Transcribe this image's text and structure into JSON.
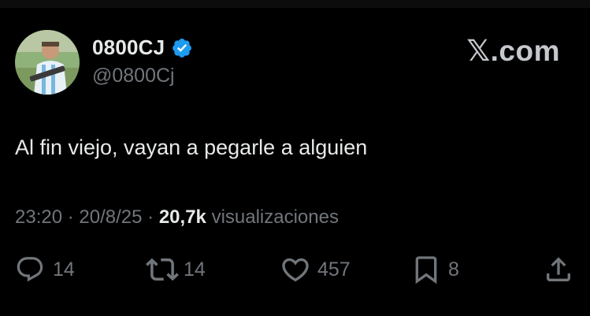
{
  "colors": {
    "background": "#000000",
    "primary_text": "#e7e9ea",
    "secondary_text": "#71767b",
    "verified_badge": "#1d9bf0"
  },
  "author": {
    "display_name": "0800CJ",
    "handle": "@0800Cj",
    "verified": true
  },
  "brand": "𝕏.com",
  "tweet": {
    "text": "Al fin viejo, vayan a pegarle a alguien"
  },
  "meta": {
    "time": "23:20",
    "date": "20/8/25",
    "views_count": "20,7k",
    "views_label": "visualizaciones",
    "separator": "·"
  },
  "actions": {
    "replies": "14",
    "reposts": "14",
    "likes": "457",
    "bookmarks": "8"
  },
  "icons": [
    "reply-icon",
    "repost-icon",
    "like-icon",
    "bookmark-icon",
    "share-icon",
    "verified-icon"
  ]
}
